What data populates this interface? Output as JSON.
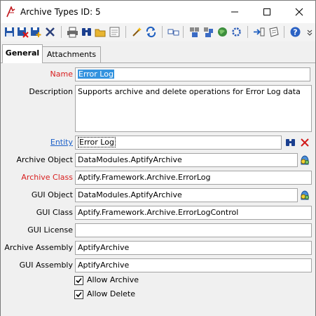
{
  "window": {
    "title": "Archive Types ID: 5"
  },
  "toolbar": {
    "icons": [
      "save-icon",
      "save-close-icon",
      "save-new-icon",
      "delete-icon",
      "print-icon",
      "find-icon",
      "open-folder-icon",
      "view-icon",
      "wizard-icon",
      "refresh-icon",
      "link-icon",
      "copy-icon",
      "paste-icon",
      "web-icon",
      "settings-icon",
      "import-icon",
      "notes-icon",
      "help-icon"
    ]
  },
  "tabs": [
    {
      "label": "General",
      "active": true
    },
    {
      "label": "Attachments",
      "active": false
    }
  ],
  "form": {
    "name": {
      "label": "Name",
      "value": "Error Log"
    },
    "description": {
      "label": "Description",
      "value": "Supports archive and delete operations for Error Log data"
    },
    "entity": {
      "label": "Entity",
      "value": "Error Log"
    },
    "archive_object": {
      "label": "Archive Object",
      "value": "DataModules.AptifyArchive"
    },
    "archive_class": {
      "label": "Archive Class",
      "value": "Aptify.Framework.Archive.ErrorLog"
    },
    "gui_object": {
      "label": "GUI Object",
      "value": "DataModules.AptifyArchive"
    },
    "gui_class": {
      "label": "GUI Class",
      "value": "Aptify.Framework.Archive.ErrorLogControl"
    },
    "gui_license": {
      "label": "GUI License",
      "value": ""
    },
    "archive_assembly": {
      "label": "Archive Assembly",
      "value": "AptifyArchive"
    },
    "gui_assembly": {
      "label": "GUI Assembly",
      "value": "AptifyArchive"
    },
    "allow_archive": {
      "label": "Allow Archive",
      "checked": true
    },
    "allow_delete": {
      "label": "Allow Delete",
      "checked": true
    }
  },
  "colors": {
    "required_label": "#d81e1e",
    "link_label": "#1a5fc8",
    "selection": "#3393df"
  }
}
